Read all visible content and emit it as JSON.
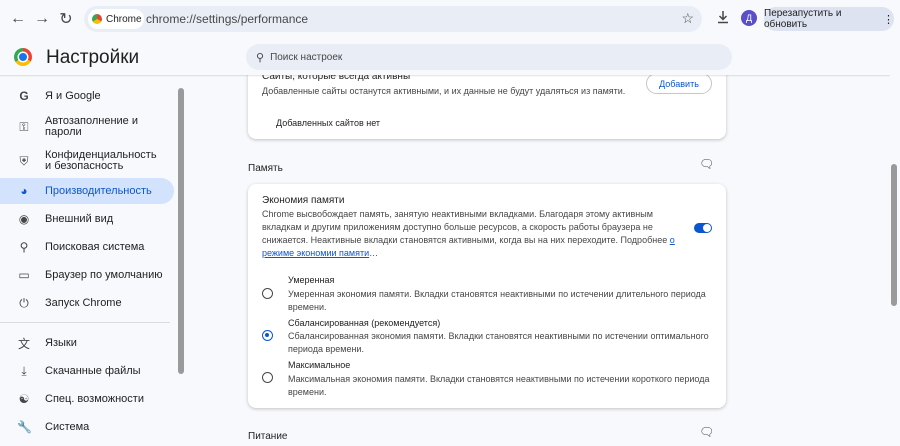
{
  "toolbar": {
    "chip_label": "Chrome",
    "url": "chrome://settings/performance",
    "profile_initial": "Д",
    "relaunch_label": "Перезапустить и обновить"
  },
  "header": {
    "title": "Настройки",
    "search_placeholder": "Поиск настроек"
  },
  "sidebar": {
    "items": [
      {
        "label": "Я и Google",
        "icon": "google-icon"
      },
      {
        "label": "Автозаполнение и пароли",
        "icon": "key-icon"
      },
      {
        "label": "Конфиденциальность и безопасность",
        "icon": "shield-icon"
      },
      {
        "label": "Производительность",
        "icon": "speedometer-icon",
        "active": true
      },
      {
        "label": "Внешний вид",
        "icon": "palette-icon"
      },
      {
        "label": "Поисковая система",
        "icon": "search-icon"
      },
      {
        "label": "Браузер по умолчанию",
        "icon": "browser-icon"
      },
      {
        "label": "Запуск Chrome",
        "icon": "power-icon"
      },
      {
        "label": "Языки",
        "icon": "translate-icon"
      },
      {
        "label": "Скачанные файлы",
        "icon": "download-icon"
      },
      {
        "label": "Спец. возможности",
        "icon": "accessibility-icon"
      },
      {
        "label": "Система",
        "icon": "wrench-icon"
      }
    ]
  },
  "always_active": {
    "title": "Сайты, которые всегда активны",
    "description": "Добавленные сайты останутся активными, и их данные не будут удаляться из памяти.",
    "add_label": "Добавить",
    "empty_text": "Добавленных сайтов нет"
  },
  "memory": {
    "section_title": "Память",
    "saver_title": "Экономия памяти",
    "saver_description": "Chrome высвобождает память, занятую неактивными вкладками. Благодаря этому активным вкладкам и другим приложениям доступно больше ресурсов, а скорость работы браузера не снижается. Неактивные вкладки становятся активными, когда вы на них переходите. Подробнее",
    "link_text": "о режиме экономии памяти",
    "ellipsis": "…",
    "saver_enabled": true,
    "options": [
      {
        "label": "Умеренная",
        "description": "Умеренная экономия памяти. Вкладки становятся неактивными по истечении длительного периода времени.",
        "selected": false
      },
      {
        "label": "Сбалансированная (рекомендуется)",
        "description": "Сбалансированная экономия памяти. Вкладки становятся неактивными по истечении оптимального периода времени.",
        "selected": true
      },
      {
        "label": "Максимальное",
        "description": "Максимальная экономия памяти. Вкладки становятся неактивными по истечении короткого периода времени.",
        "selected": false
      }
    ]
  },
  "power": {
    "section_title": "Питание"
  },
  "colors": {
    "accent": "#0b57d0",
    "active_nav_bg": "#d3e3fd",
    "page_bg": "#f8f9fc"
  }
}
